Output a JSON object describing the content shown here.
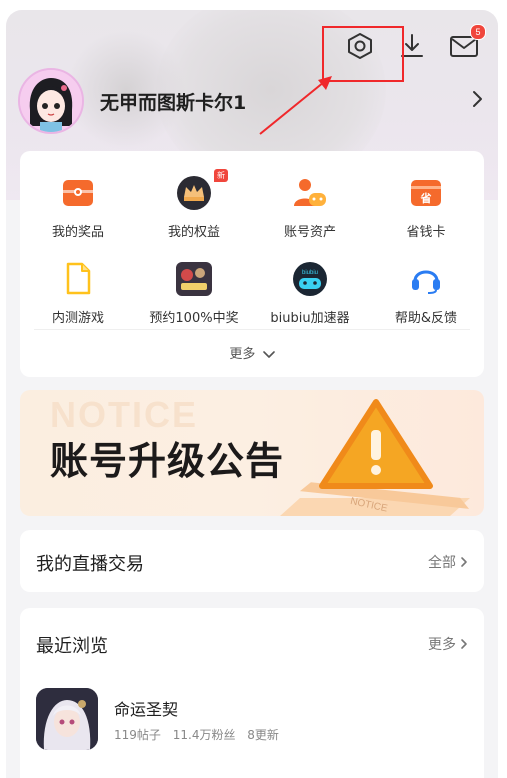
{
  "header": {
    "settings_icon": "settings-hexagon-icon",
    "download_icon": "download-icon",
    "mail_icon": "mail-icon",
    "mail_badge": "5",
    "highlight_color": "#f0282b"
  },
  "profile": {
    "username": "无甲而图斯卡尔1"
  },
  "grid": {
    "row1": [
      {
        "label": "我的奖品",
        "icon": "gift-box-icon"
      },
      {
        "label": "我的权益",
        "icon": "crown-avatar-icon",
        "tag": "新"
      },
      {
        "label": "账号资产",
        "icon": "account-assets-icon"
      },
      {
        "label": "省钱卡",
        "icon": "savings-card-icon"
      }
    ],
    "row2": [
      {
        "label": "内测游戏",
        "icon": "document-icon"
      },
      {
        "label": "预约100%中奖",
        "icon": "game-thumbnail-icon"
      },
      {
        "label": "biubiu加速器",
        "icon": "biubiu-accelerator-icon"
      },
      {
        "label": "帮助&反馈",
        "icon": "headset-icon"
      }
    ],
    "more_label": "更多"
  },
  "banner": {
    "watermark": "NOTICE",
    "title": "账号升级公告",
    "sign_text": "NOTICE",
    "accent": "#f5a623"
  },
  "live_trade": {
    "title": "我的直播交易",
    "more": "全部"
  },
  "recent": {
    "title": "最近浏览",
    "more": "更多",
    "item": {
      "name": "命运圣契",
      "posts": "119帖子",
      "fans": "11.4万粉丝",
      "updates": "8更新"
    }
  }
}
